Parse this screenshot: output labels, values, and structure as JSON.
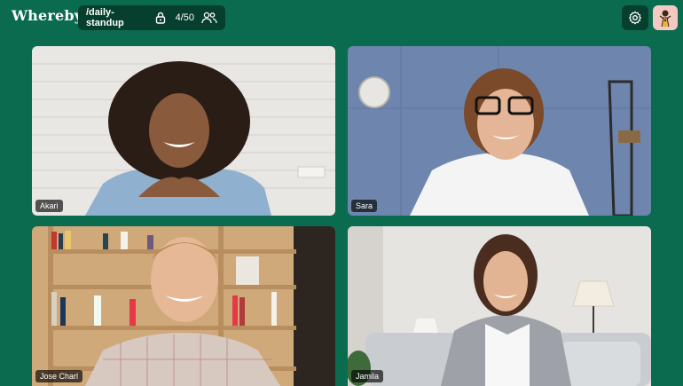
{
  "header": {
    "logo": "Whereby",
    "room": {
      "name": "/daily-standup",
      "participants": "4/50",
      "lock_icon": "lock-icon",
      "people_icon": "people-icon"
    },
    "settings_icon": "gear-icon",
    "avatar_icon": "user-avatar"
  },
  "participants": [
    {
      "name": "Akari"
    },
    {
      "name": "Sara"
    },
    {
      "name": "Jose Charl"
    },
    {
      "name": "Jamila"
    }
  ],
  "colors": {
    "background": "#0b6b4e",
    "pill": "#063f2d",
    "avatar_bg": "#f3c9c2"
  }
}
